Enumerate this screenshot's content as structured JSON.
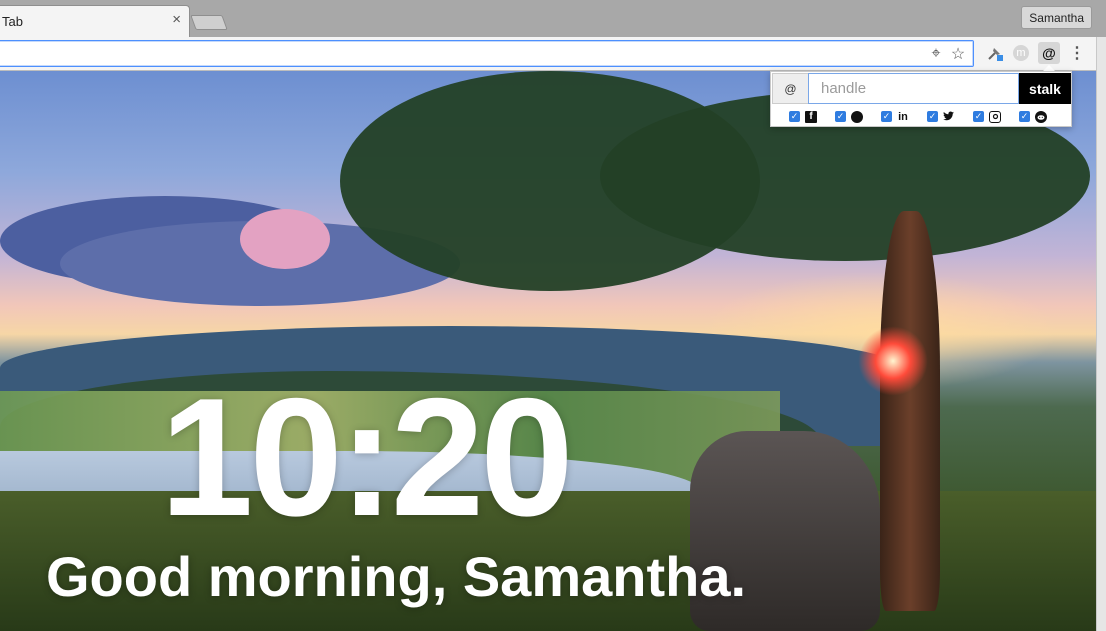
{
  "browser": {
    "tab_title": "Tab",
    "tab_close": "×",
    "profile_name": "Samantha",
    "address_value": "",
    "icons": {
      "location": "target-icon",
      "bookmark": "star-icon",
      "ext1": "pin-extension-icon",
      "ext2": "m-extension-icon",
      "ext3": "at-extension-icon",
      "menu": "kebab-menu-icon"
    },
    "ext_m_label": "m",
    "ext_at_label": "@",
    "menu_glyph": "⋮",
    "star_glyph": "☆",
    "target_glyph": "⌖"
  },
  "newtab": {
    "time": "10:20",
    "greeting": "Good morning, Samantha."
  },
  "stalk_popup": {
    "at_label": "@",
    "handle_placeholder": "handle",
    "handle_value": "",
    "button_label": "stalk",
    "networks": [
      {
        "name": "facebook",
        "icon": "facebook-icon",
        "glyph": "f",
        "checked": true
      },
      {
        "name": "github",
        "icon": "github-icon",
        "glyph": "●",
        "checked": true
      },
      {
        "name": "linkedin",
        "icon": "linkedin-icon",
        "glyph": "in",
        "checked": true
      },
      {
        "name": "twitter",
        "icon": "twitter-icon",
        "glyph": "🐦",
        "checked": true
      },
      {
        "name": "instagram",
        "icon": "instagram-icon",
        "glyph": "◎",
        "checked": true
      },
      {
        "name": "reddit",
        "icon": "reddit-icon",
        "glyph": "●",
        "checked": true
      }
    ],
    "check_glyph": "✓",
    "accent_color": "#2f7ce0"
  }
}
